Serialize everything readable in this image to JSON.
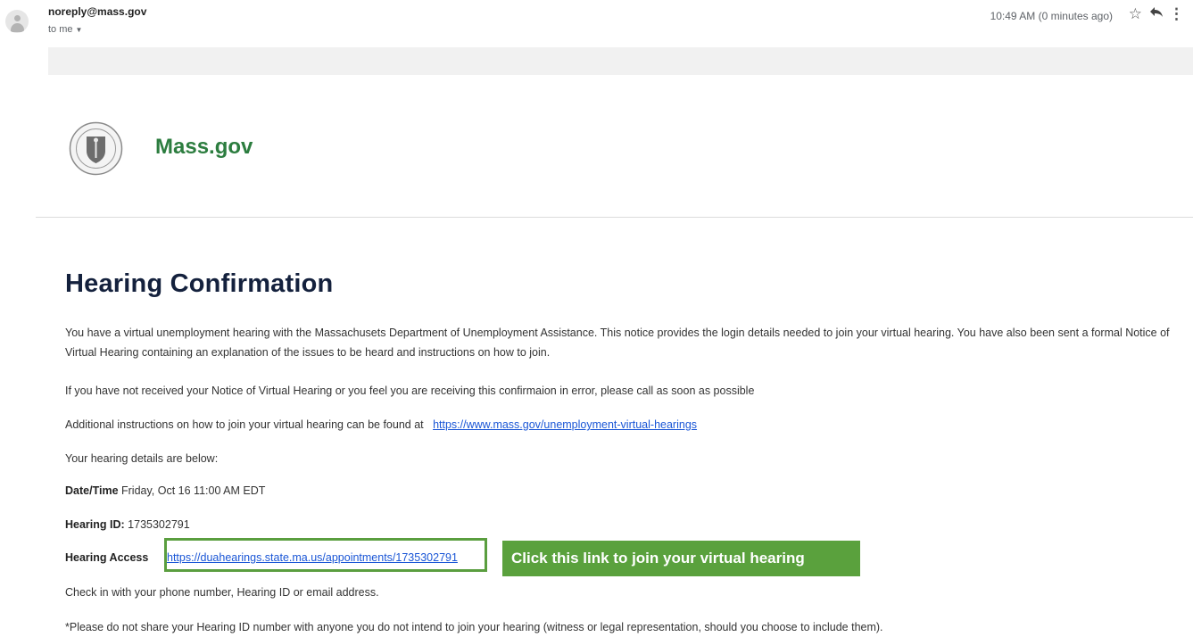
{
  "header": {
    "sender": "noreply@mass.gov",
    "recipient": "to me",
    "time": "10:49 AM (0 minutes ago)",
    "icons": [
      "star-icon",
      "reply-icon",
      "more-vert-icon",
      "avatar-icon",
      "chevron-down-icon"
    ]
  },
  "brand": {
    "name": "Mass.gov",
    "color": "#2c7d3f"
  },
  "email": {
    "title": "Hearing Confirmation",
    "paragraph1": "You have a virtual unemployment hearing with the Massachusets Department of Unemployment Assistance. This notice provides the login details needed to join your virtual hearing. You have also been sent a formal Notice of Virtual Hearing containing an explanation of the issues to be heard and instructions on how to join.",
    "paragraph2": "If you have not received your Notice of Virtual Hearing or you feel you are receiving this confirmaion in error, please call as soon as possible",
    "instructions_text": "Additional instructions on how to join your virtual hearing can be found at",
    "instructions_link": "https://www.mass.gov/unemployment-virtual-hearings",
    "details_intro": "Your hearing details are below:",
    "datetime_label": "Date/Time",
    "datetime_value": "Friday, Oct 16 11:00 AM EDT",
    "hearing_id_label": "Hearing ID:",
    "hearing_id_value": "1735302791",
    "access_label": "Hearing Access",
    "access_link": "https://duahearings.state.ma.us/appointments/1735302791",
    "checkin_text": "Check in with your phone number, Hearing ID or email address.",
    "warning_text": "*Please do not share your Hearing ID number with anyone you do not intend to join your hearing (witness or legal representation, should you choose to include them)."
  },
  "callout": {
    "text": "Click this link to join your virtual hearing",
    "color": "#5aa13d"
  },
  "colors": {
    "link": "#1a56d6",
    "title": "#14213d",
    "highlight_border": "#5a9e3f"
  }
}
